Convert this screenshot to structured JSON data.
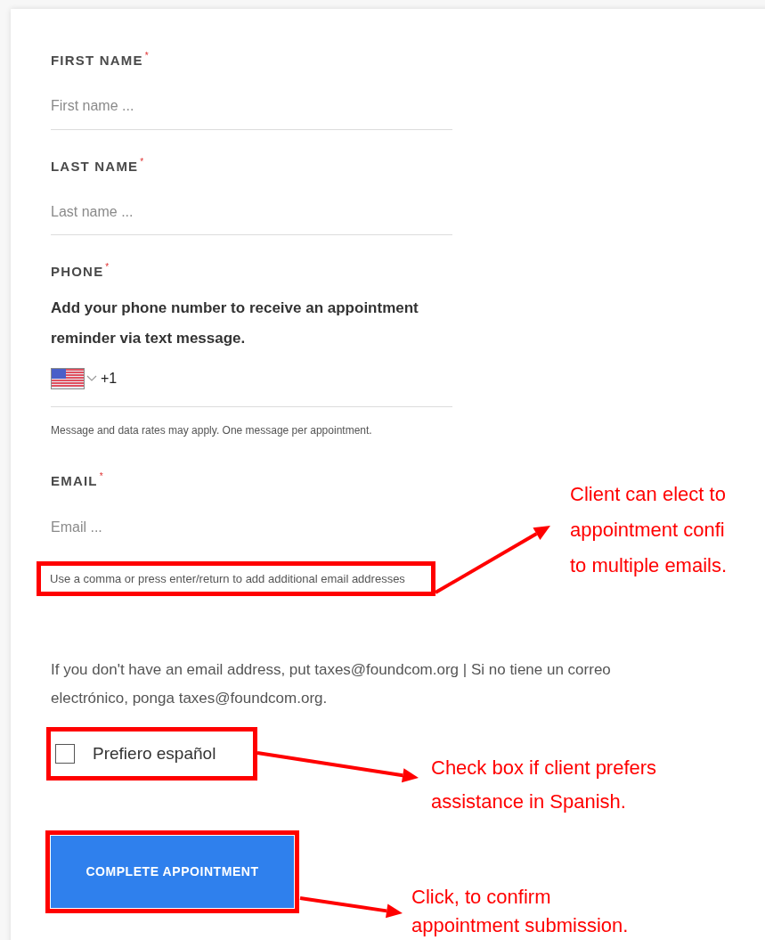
{
  "form": {
    "fields": [
      {
        "kind": "text",
        "label": "FIRST NAME",
        "required_mark": "*",
        "placeholder": "First name ..."
      },
      {
        "kind": "text",
        "label": "LAST NAME",
        "required_mark": "*",
        "placeholder": "Last name ..."
      },
      {
        "kind": "phone",
        "label": "PHONE",
        "required_mark": "*",
        "description": "Add your phone number to receive an appointment reminder via text message.",
        "dial_code": "+1",
        "note": "Message and data rates may apply. One message per appointment."
      },
      {
        "kind": "email",
        "label": "EMAIL",
        "required_mark": "*",
        "placeholder": "Email ...",
        "help": "Use a comma or press enter/return to add additional email addresses"
      }
    ],
    "notice": "If you don't have an email address, put taxes@foundcom.org | Si no tiene un correo electrónico, ponga taxes@foundcom.org.",
    "checkbox": {
      "label": "Prefiero español",
      "checked": false
    },
    "submit_button": "COMPLETE APPOINTMENT"
  },
  "annotations": [
    {
      "kind": "email_help",
      "lines": [
        "Client can elect to",
        "appointment confi",
        "to multiple emails."
      ]
    },
    {
      "kind": "checkbox",
      "lines": [
        "Check box if client prefers",
        "assistance in Spanish."
      ]
    },
    {
      "kind": "submit_button",
      "lines": [
        "Click, to confirm",
        "appointment submission."
      ]
    }
  ]
}
